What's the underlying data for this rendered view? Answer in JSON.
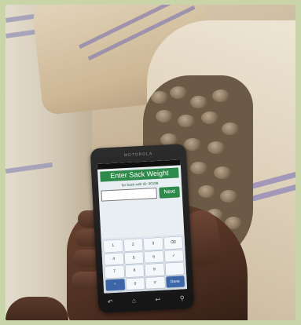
{
  "phone": {
    "brand": "MOTOROLA",
    "status": "",
    "heading": "Enter Sack Weight",
    "subheading": "for Sack with ID: 00198",
    "input_value": "",
    "next_label": "Next",
    "keys": [
      "1",
      "2",
      "3",
      "⌫",
      "4",
      "5",
      "6",
      "✓",
      "7",
      "8",
      "9",
      "",
      "*",
      "0",
      "#",
      "Done"
    ],
    "nav_icons": [
      "back-icon",
      "home-icon",
      "recent-icon",
      "search-icon"
    ]
  },
  "colors": {
    "heading_green": "#2e8a4a",
    "frame": "#c9d4a9",
    "sack_stripe": "#8e84b8"
  }
}
